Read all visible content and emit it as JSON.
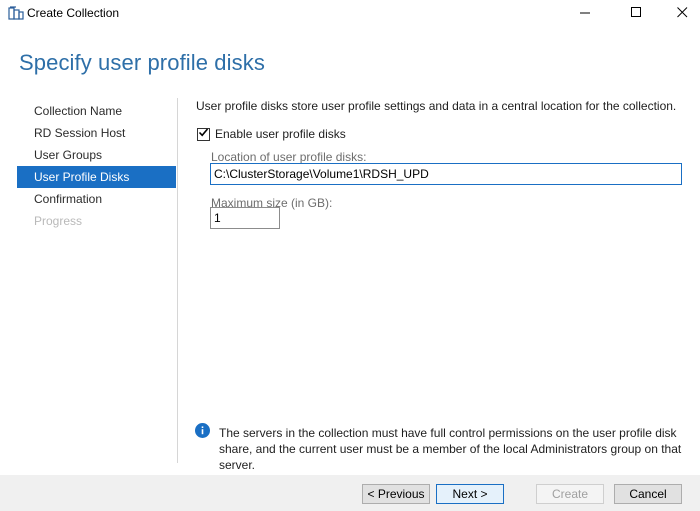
{
  "window": {
    "title": "Create Collection",
    "app_icon": "server-collection-icon",
    "controls": [
      "minimize-icon",
      "maximize-icon",
      "close-icon"
    ]
  },
  "page": {
    "title": "Specify user profile disks"
  },
  "nav": {
    "items": [
      {
        "label": "Collection Name",
        "state": "normal"
      },
      {
        "label": "RD Session Host",
        "state": "normal"
      },
      {
        "label": "User Groups",
        "state": "normal"
      },
      {
        "label": "User Profile Disks",
        "state": "active"
      },
      {
        "label": "Confirmation",
        "state": "normal"
      },
      {
        "label": "Progress",
        "state": "disabled"
      }
    ]
  },
  "main": {
    "description": "User profile disks store user profile settings and data in a central location for the collection.",
    "enable_checkbox": {
      "label": "Enable user profile disks",
      "checked": true
    },
    "location": {
      "label": "Location of user profile disks:",
      "value": "C:\\ClusterStorage\\Volume1\\RDSH_UPD"
    },
    "max_size": {
      "label": "Maximum size (in GB):",
      "value": "1"
    },
    "info_note": "The servers in the collection must have full control permissions on the user profile disk share, and the current user must be a member of the local Administrators group on that server."
  },
  "footer": {
    "previous": "< Previous",
    "next": "Next >",
    "create": "Create",
    "cancel": "Cancel"
  },
  "colors": {
    "accent": "#1a6fc4",
    "title": "#2e6fa8",
    "disabled_text": "#b9b9b9"
  }
}
